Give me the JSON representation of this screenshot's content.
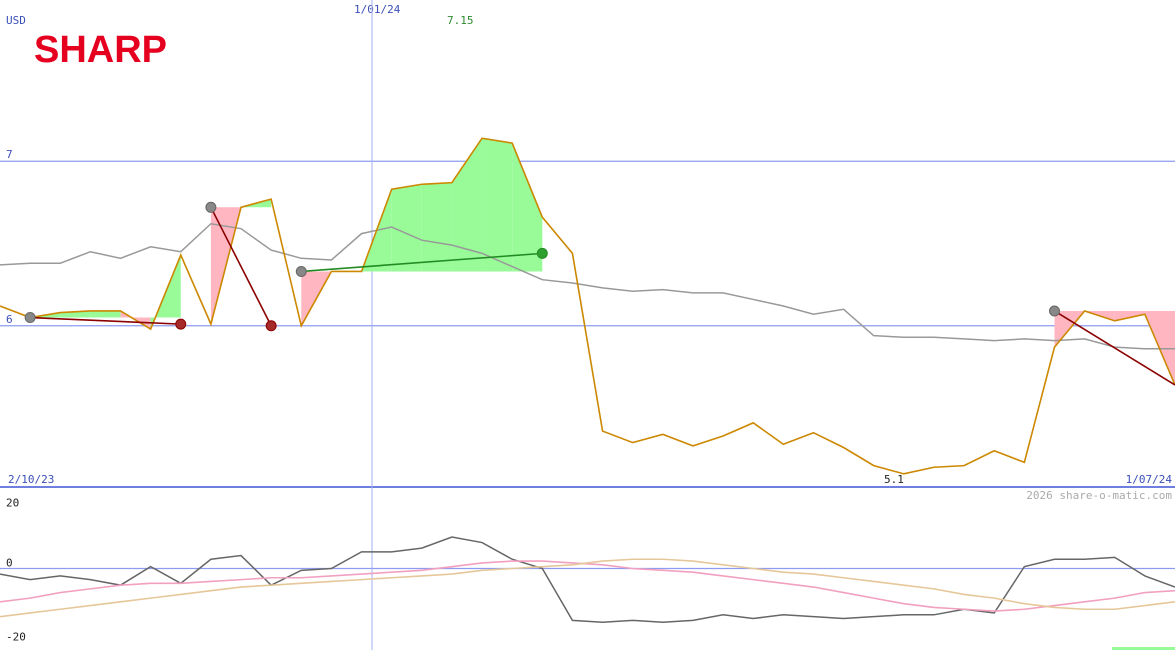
{
  "logo_text": "SHARP",
  "currency_label": "USD",
  "watermark": "2026 share-o-matic.com",
  "colors": {
    "price_line": "#cc8800",
    "ma_line": "#999999",
    "grid": "#8d9cf0",
    "up_fill": "#98fb98",
    "down_fill": "#ffb6c1",
    "trade_up": "#228b22",
    "trade_down": "#8b0000",
    "osc_line": "#666666",
    "osc_pink": "#f2a0c0",
    "osc_tan": "#e6c79a"
  },
  "chart_data": [
    {
      "type": "line",
      "name": "price",
      "x_start_label": "2/10/23",
      "x_end_label": "1/07/24",
      "x_marker_label": "1/01/24",
      "max_label": "7.15",
      "min_label": "5.1",
      "y_ticks": [
        {
          "value": 7,
          "label": "7"
        },
        {
          "value": 6,
          "label": "6"
        }
      ],
      "ylim": [
        5.02,
        7.98
      ],
      "series": [
        {
          "values": [
            6.12,
            6.05,
            6.08,
            6.09,
            6.09,
            5.98,
            6.43,
            6.01,
            6.72,
            6.77,
            6.0,
            6.33,
            6.33,
            6.83,
            6.86,
            6.87,
            7.14,
            7.11,
            6.66,
            6.44,
            5.36,
            5.29,
            5.34,
            5.27,
            5.33,
            5.41,
            5.28,
            5.35,
            5.26,
            5.15,
            5.1,
            5.14,
            5.15,
            5.24,
            5.17,
            5.87,
            6.09,
            6.03,
            6.07,
            5.64
          ]
        },
        {
          "values": [
            6.37,
            6.38,
            6.38,
            6.45,
            6.41,
            6.48,
            6.45,
            6.62,
            6.59,
            6.46,
            6.41,
            6.4,
            6.56,
            6.6,
            6.52,
            6.49,
            6.44,
            6.36,
            6.28,
            6.26,
            6.23,
            6.21,
            6.22,
            6.2,
            6.2,
            6.16,
            6.12,
            6.07,
            6.1,
            5.94,
            5.93,
            5.93,
            5.92,
            5.91,
            5.92,
            5.91,
            5.92,
            5.87,
            5.86,
            5.86
          ]
        }
      ],
      "trades": [
        {
          "from": 1,
          "to": 6,
          "from_value": 6.05,
          "to_value": 6.01,
          "result": "loss"
        },
        {
          "from": 7,
          "to": 9,
          "from_value": 6.72,
          "to_value": 6.0,
          "result": "loss"
        },
        {
          "from": 10,
          "to": 18,
          "from_value": 6.33,
          "to_value": 6.44,
          "result": "gain"
        },
        {
          "from": 35,
          "to": 39,
          "from_value": 6.09,
          "to_value": 5.64,
          "result": "loss"
        }
      ]
    },
    {
      "type": "line",
      "name": "oscillator",
      "y_ticks": [
        {
          "value": 20,
          "label": "20"
        },
        {
          "value": 0,
          "label": "0"
        },
        {
          "value": -20,
          "label": "-20"
        }
      ],
      "ylim": [
        -22,
        22
      ],
      "series": [
        {
          "values": [
            -1.5,
            -3.0,
            -2.0,
            -3.0,
            -4.5,
            0.5,
            -4.0,
            2.5,
            3.5,
            -4.5,
            -0.5,
            0.0,
            4.5,
            4.5,
            5.5,
            8.5,
            7.0,
            2.5,
            0.0,
            -14.0,
            -14.5,
            -14.0,
            -14.5,
            -14.0,
            -12.5,
            -13.5,
            -12.5,
            -13.0,
            -13.5,
            -13.0,
            -12.5,
            -12.5,
            -11.0,
            -12.0,
            0.5,
            2.5,
            2.5,
            3.0,
            -2.0,
            -5.0
          ]
        },
        {
          "values": [
            -9.0,
            -8.0,
            -6.5,
            -5.5,
            -4.5,
            -4.0,
            -4.0,
            -3.5,
            -3.0,
            -2.5,
            -2.5,
            -2.0,
            -1.5,
            -1.0,
            -0.5,
            0.5,
            1.5,
            2.0,
            2.0,
            1.5,
            1.0,
            0.0,
            -0.5,
            -1.0,
            -2.0,
            -3.0,
            -4.0,
            -5.0,
            -6.5,
            -8.0,
            -9.5,
            -10.5,
            -11.0,
            -11.5,
            -11.0,
            -10.0,
            -9.0,
            -8.0,
            -6.5,
            -6.0
          ]
        },
        {
          "values": [
            -13.0,
            -12.0,
            -11.0,
            -10.0,
            -9.0,
            -8.0,
            -7.0,
            -6.0,
            -5.0,
            -4.5,
            -4.0,
            -3.5,
            -3.0,
            -2.5,
            -2.0,
            -1.5,
            -0.5,
            0.0,
            0.5,
            1.0,
            2.0,
            2.5,
            2.5,
            2.0,
            1.0,
            0.0,
            -1.0,
            -1.5,
            -2.5,
            -3.5,
            -4.5,
            -5.5,
            -7.0,
            -8.0,
            -9.5,
            -10.5,
            -11.0,
            -11.0,
            -10.0,
            -9.0
          ]
        }
      ]
    }
  ]
}
